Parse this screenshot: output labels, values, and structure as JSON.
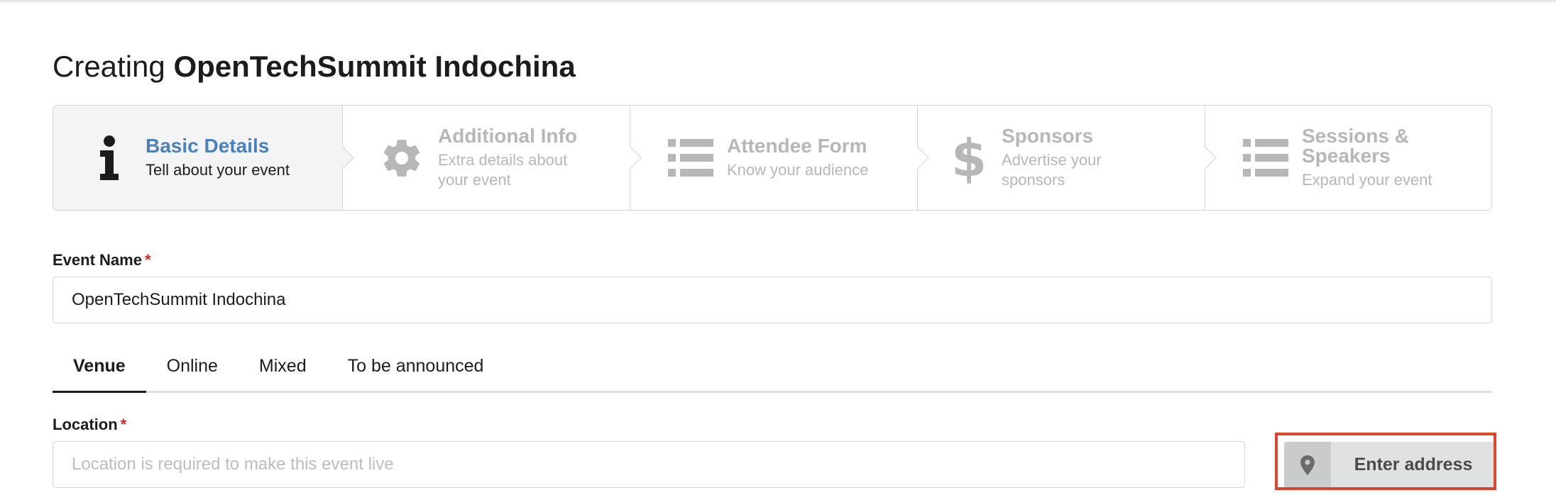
{
  "title": {
    "prefix": "Creating",
    "event_name": "OpenTechSummit Indochina"
  },
  "steps": [
    {
      "title": "Basic Details",
      "desc": "Tell about your event",
      "icon": "info-icon",
      "active": true
    },
    {
      "title": "Additional Info",
      "desc": "Extra details about your event",
      "icon": "gear-icon",
      "active": false
    },
    {
      "title": "Attendee Form",
      "desc": "Know your audience",
      "icon": "list-icon",
      "active": false
    },
    {
      "title": "Sponsors",
      "desc": "Advertise your sponsors",
      "icon": "dollar-icon",
      "active": false
    },
    {
      "title": "Sessions & Speakers",
      "desc": "Expand your event",
      "icon": "list-icon",
      "active": false
    }
  ],
  "event_name_field": {
    "label": "Event Name",
    "required_mark": "*",
    "value": "OpenTechSummit Indochina"
  },
  "location_tabs": [
    {
      "label": "Venue",
      "active": true
    },
    {
      "label": "Online",
      "active": false
    },
    {
      "label": "Mixed",
      "active": false
    },
    {
      "label": "To be announced",
      "active": false
    }
  ],
  "location_field": {
    "label": "Location",
    "required_mark": "*",
    "placeholder": "Location is required to make this event live",
    "value": ""
  },
  "enter_address_button": {
    "label": "Enter address",
    "icon": "map-pin-icon"
  },
  "colors": {
    "active_step_title": "#4a80bd",
    "inactive_step": "#b7b7b7",
    "required": "#db2828",
    "highlight": "#e0442f"
  }
}
